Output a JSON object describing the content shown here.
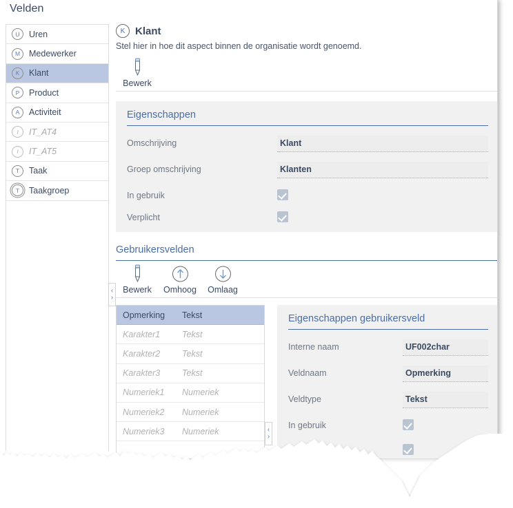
{
  "window": {
    "title": "Velden"
  },
  "sidebar": {
    "items": [
      {
        "label": "Uren",
        "badge": "U",
        "state": "normal",
        "icon": "circle-letter-icon"
      },
      {
        "label": "Medewerker",
        "badge": "M",
        "state": "normal",
        "icon": "circle-letter-icon"
      },
      {
        "label": "Klant",
        "badge": "K",
        "state": "selected",
        "icon": "circle-letter-icon"
      },
      {
        "label": "Product",
        "badge": "P",
        "state": "normal",
        "icon": "circle-letter-icon"
      },
      {
        "label": "Activiteit",
        "badge": "A",
        "state": "normal",
        "icon": "circle-letter-icon"
      },
      {
        "label": "IT_AT4",
        "badge": "I",
        "state": "disabled",
        "icon": "circle-letter-icon"
      },
      {
        "label": "IT_AT5",
        "badge": "I",
        "state": "disabled",
        "icon": "circle-letter-icon"
      },
      {
        "label": "Taak",
        "badge": "T",
        "state": "normal",
        "icon": "circle-letter-icon"
      },
      {
        "label": "Taakgroep",
        "badge": "T",
        "state": "normal",
        "icon": "double-circle-letter-icon"
      }
    ]
  },
  "aspect": {
    "badge": "K",
    "title": "Klant",
    "subtitle": "Stel hier in hoe dit aspect binnen de organisatie wordt genoemd."
  },
  "toolbar_main": {
    "buttons": [
      {
        "label": "Bewerk",
        "icon": "pencil-icon"
      }
    ]
  },
  "properties": {
    "title": "Eigenschappen",
    "rows": [
      {
        "label": "Omschrijving",
        "type": "text",
        "value": "Klant"
      },
      {
        "label": "Groep omschrijving",
        "type": "text",
        "value": "Klanten"
      },
      {
        "label": "In gebruik",
        "type": "checkbox",
        "checked": true
      },
      {
        "label": "Verplicht",
        "type": "checkbox",
        "checked": true
      }
    ]
  },
  "userfields": {
    "title": "Gebruikersvelden",
    "toolbar": [
      {
        "label": "Bewerk",
        "icon": "pencil-icon"
      },
      {
        "label": "Omhoog",
        "icon": "arrow-up-circle-icon"
      },
      {
        "label": "Omlaag",
        "icon": "arrow-down-circle-icon"
      }
    ],
    "columns": [
      "Opmerking",
      "Tekst"
    ],
    "rows": [
      {
        "name": "Karakter1",
        "type": "Tekst",
        "state": "dim"
      },
      {
        "name": "Karakter2",
        "type": "Tekst",
        "state": "dim"
      },
      {
        "name": "Karakter3",
        "type": "Tekst",
        "state": "dim"
      },
      {
        "name": "Numeriek1",
        "type": "Numeriek",
        "state": "dim"
      },
      {
        "name": "Numeriek2",
        "type": "Numeriek",
        "state": "dim"
      },
      {
        "name": "Numeriek3",
        "type": "Numeriek",
        "state": "dim"
      }
    ]
  },
  "userfield_properties": {
    "title": "Eigenschappen gebruikersveld",
    "rows": [
      {
        "label": "Interne naam",
        "type": "text",
        "value": "UF002char"
      },
      {
        "label": "Veldnaam",
        "type": "text",
        "value": "Opmerking"
      },
      {
        "label": "Veldtype",
        "type": "text",
        "value": "Tekst"
      },
      {
        "label": "In gebruik",
        "type": "checkbox",
        "checked": true
      },
      {
        "label": "",
        "type": "checkbox",
        "checked": true
      }
    ]
  },
  "splitters": {
    "collapse_left": "‹",
    "expand_right": "›"
  },
  "colors": {
    "accent": "#4a6da8",
    "selection": "#b9c7e2",
    "panel_bg": "#f1f1f1",
    "text": "#3b4a63",
    "muted": "#b2b2b2",
    "checkbox": "#b9c4d2"
  }
}
